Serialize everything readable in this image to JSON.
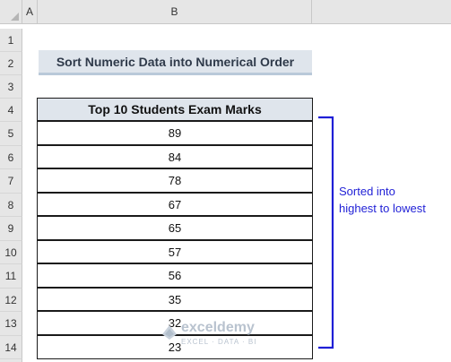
{
  "sheet": {
    "columns": [
      "A",
      "B"
    ],
    "rows": [
      "1",
      "2",
      "3",
      "4",
      "5",
      "6",
      "7",
      "8",
      "9",
      "10",
      "11",
      "12",
      "13",
      "14"
    ]
  },
  "title": "Sort Numeric Data into Numerical Order",
  "table": {
    "header": "Top 10 Students Exam Marks",
    "values": [
      "89",
      "84",
      "78",
      "67",
      "65",
      "57",
      "56",
      "35",
      "32",
      "23"
    ]
  },
  "note": "Sorted into highest to lowest",
  "watermark": {
    "name": "exceldemy",
    "tagline": "EXCEL · DATA · BI"
  },
  "colors": {
    "bracket": "#1f1fd6",
    "header_fill": "#dfe5ec"
  }
}
